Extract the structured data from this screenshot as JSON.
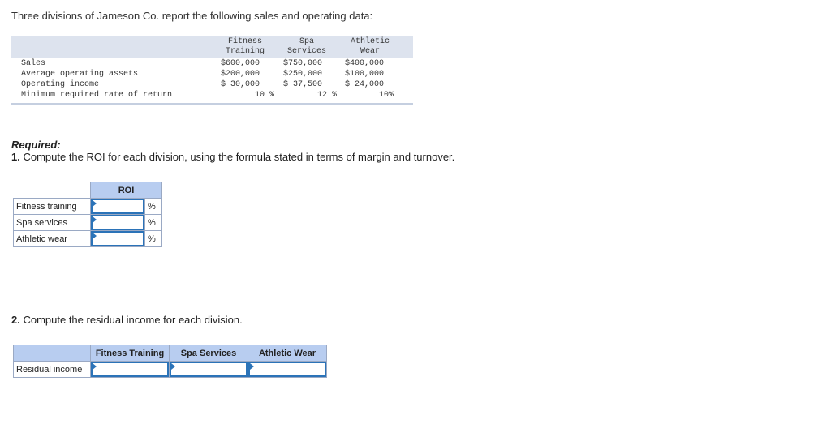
{
  "intro": "Three divisions of Jameson Co. report the following sales and operating data:",
  "data_table": {
    "columns": [
      {
        "line1": "Fitness",
        "line2": "Training"
      },
      {
        "line1": "Spa",
        "line2": "Services"
      },
      {
        "line1": "Athletic",
        "line2": "Wear"
      }
    ],
    "rows": [
      {
        "label": "Sales",
        "values": [
          "$600,000",
          "$750,000",
          "$400,000"
        ]
      },
      {
        "label": "Average operating assets",
        "values": [
          "$200,000",
          "$250,000",
          "$100,000"
        ]
      },
      {
        "label": "Operating income",
        "values": [
          "$ 30,000",
          "$ 37,500",
          "$ 24,000"
        ]
      },
      {
        "label": "Minimum required rate of return",
        "values": [
          "10 %",
          "12 %",
          "10%"
        ]
      }
    ]
  },
  "required": {
    "title": "Required:",
    "part1_num": "1.",
    "part1_text": " Compute the ROI for each division, using the formula stated in terms of margin and turnover.",
    "part2_num": "2.",
    "part2_text": " Compute the residual income for each division."
  },
  "roi_table": {
    "header": "ROI",
    "rows": [
      {
        "label": "Fitness training",
        "value": "",
        "unit": "%"
      },
      {
        "label": "Spa services",
        "value": "",
        "unit": "%"
      },
      {
        "label": "Athletic wear",
        "value": "",
        "unit": "%"
      }
    ]
  },
  "ri_table": {
    "headers": [
      "Fitness Training",
      "Spa Services",
      "Athletic Wear"
    ],
    "row_label": "Residual income",
    "values": [
      "",
      "",
      ""
    ]
  },
  "colors": {
    "header_fill": "#b8cdf0",
    "input_border": "#2b73b8",
    "data_header_fill": "#dde3ee"
  }
}
